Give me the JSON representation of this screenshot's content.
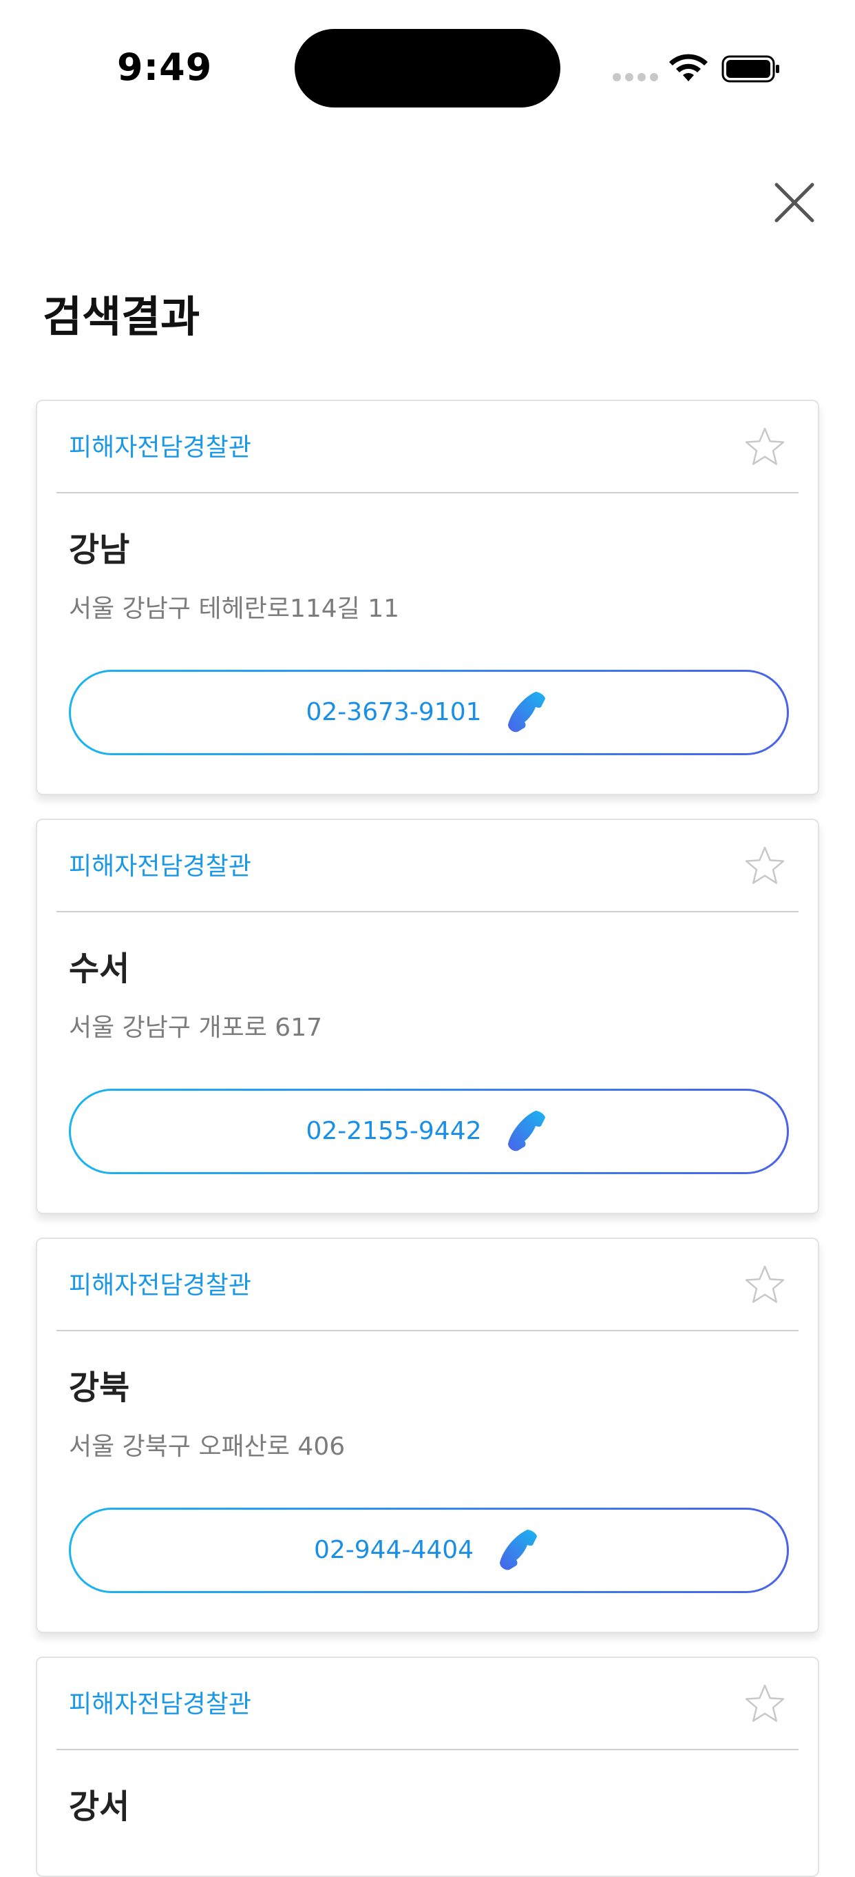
{
  "status_bar": {
    "time": "9:49"
  },
  "header": {
    "title": "검색결과",
    "close_icon": "close-icon"
  },
  "colors": {
    "accent": "#1a98e6",
    "gradient_start": "#1ab4f0",
    "gradient_end": "#4a63e8",
    "star_outline": "#c8c8c8"
  },
  "results": [
    {
      "category": "피해자전담경찰관",
      "name": "강남",
      "address": "서울 강남구 테헤란로114길 11",
      "phone": "02-3673-9101",
      "favorite": false
    },
    {
      "category": "피해자전담경찰관",
      "name": "수서",
      "address": "서울 강남구 개포로 617",
      "phone": "02-2155-9442",
      "favorite": false
    },
    {
      "category": "피해자전담경찰관",
      "name": "강북",
      "address": "서울 강북구 오패산로 406",
      "phone": "02-944-4404",
      "favorite": false
    },
    {
      "category": "피해자전담경찰관",
      "name": "강서",
      "address": "",
      "phone": "",
      "favorite": false
    }
  ]
}
